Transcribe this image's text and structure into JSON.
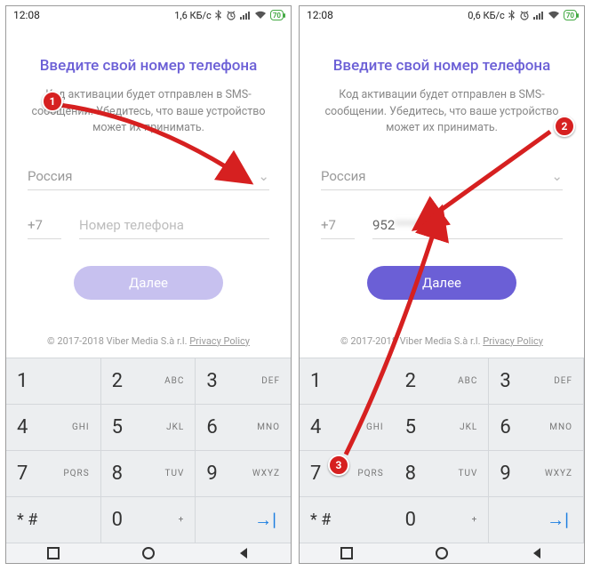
{
  "screens": [
    {
      "status": {
        "time": "12:08",
        "net": "1,6 КБ/с",
        "battery": "70"
      },
      "title": "Введите свой номер телефона",
      "subtitle": "Код активации будет отправлен в SMS-сообщении. Убедитесь, что ваше устройство может их принимать.",
      "country": "Россия",
      "cc": "+7",
      "phone_placeholder": "Номер телефона",
      "phone_value": "",
      "next": "Далее",
      "next_enabled": false,
      "footer_copy": "© 2017-2018 Viber Media S.à r.l.",
      "footer_link": "Privacy Policy",
      "callouts": [
        1
      ],
      "arrows": [
        "down-right"
      ]
    },
    {
      "status": {
        "time": "12:08",
        "net": "0,6 КБ/с",
        "battery": "70"
      },
      "title": "Введите свой номер телефона",
      "subtitle": "Код активации будет отправлен в SMS-сообщении. Убедитесь, что ваше устройство может их принимать.",
      "country": "Россия",
      "cc": "+7",
      "phone_placeholder": "",
      "phone_value": "952",
      "phone_value_blurred": "*******",
      "next": "Далее",
      "next_enabled": true,
      "footer_copy": "© 2017-2018 Viber Media S.à r.l.",
      "footer_link": "Privacy Policy",
      "callouts": [
        2,
        3
      ],
      "arrows": [
        "to-phone",
        "to-next"
      ]
    }
  ],
  "keypad": [
    {
      "d": "1",
      "l": ""
    },
    {
      "d": "2",
      "l": "ABC"
    },
    {
      "d": "3",
      "l": "DEF"
    },
    {
      "d": "4",
      "l": "GHI"
    },
    {
      "d": "5",
      "l": "JKL"
    },
    {
      "d": "6",
      "l": "MNO"
    },
    {
      "d": "7",
      "l": "PQRS"
    },
    {
      "d": "8",
      "l": "TUV"
    },
    {
      "d": "9",
      "l": "WXYZ"
    },
    {
      "d": "* #",
      "l": ""
    },
    {
      "d": "0",
      "l": "+"
    },
    {
      "d": "→|",
      "l": ""
    }
  ]
}
